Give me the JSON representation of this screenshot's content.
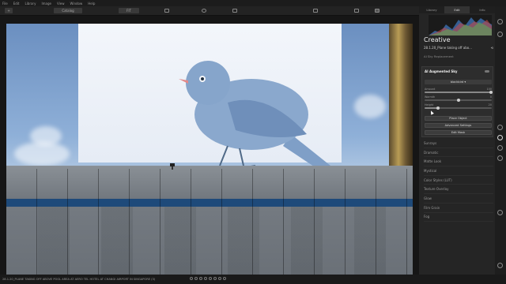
{
  "menu": [
    "File",
    "Edit",
    "Library",
    "Image",
    "View",
    "Window",
    "Help"
  ],
  "toolbar": {
    "add_label": "+",
    "catalog_label": "Catalog",
    "zoom_label": "FIT",
    "crop_label": "⌃"
  },
  "panel": {
    "tabs": [
      {
        "label": "Library"
      },
      {
        "label": "Edit"
      },
      {
        "label": "Info"
      }
    ],
    "section_title": "Creative",
    "preset_name": "28.1.20_Plane taking off abo...",
    "preset_icon": "⟲",
    "subsection": "AI Sky Replacement",
    "tool": {
      "title": "AI Augmented Sky",
      "dropdown_value": "blackbird",
      "sliders": [
        {
          "label": "Amount",
          "value": "100",
          "level": 0.98
        },
        {
          "label": "Warmth",
          "value": "0",
          "level": 0.5
        },
        {
          "label": "Height",
          "value": "20",
          "level": 0.2
        }
      ],
      "buttons": [
        "Place Object",
        "Advanced Settings",
        "Edit Mask"
      ]
    },
    "tools": [
      "Sunrays",
      "Dramatic",
      "Matte Look",
      "Mystical",
      "Color Styles (LUT)",
      "Texture Overlay",
      "Glow",
      "Film Grain",
      "Fog"
    ]
  },
  "status": {
    "caption": "28.1.20_PLANE TAKING OFF ABOVE POOL AREA AT AERO TEL HOTEL AT CHANGI AIRPORT IN SINGAPORE (3)"
  },
  "colors": {
    "panel_bg": "#252525",
    "accent": "#cfcfcf",
    "bird": "#7f9fc7"
  }
}
